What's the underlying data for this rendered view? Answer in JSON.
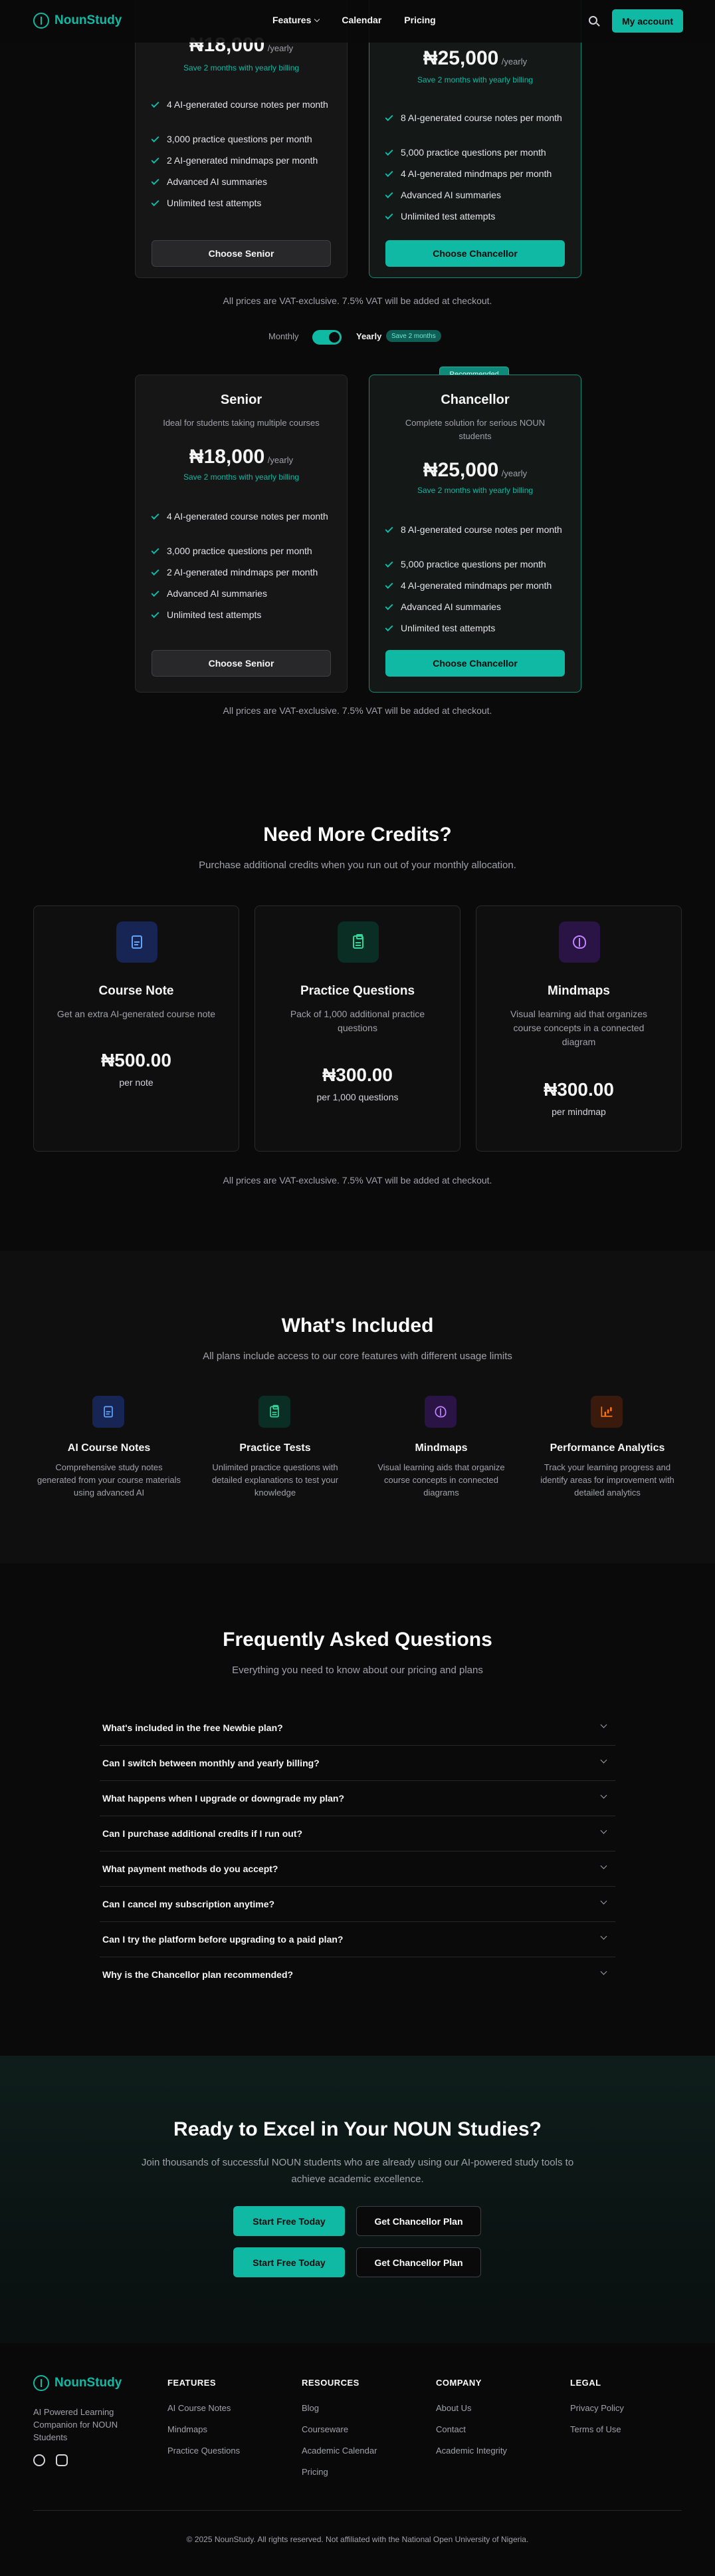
{
  "nav": {
    "brand": "NounStudy",
    "features": "Features",
    "calendar": "Calendar",
    "pricing": "Pricing",
    "account": "My account"
  },
  "plans_top": {
    "senior": {
      "price": "₦18,000",
      "period": "/yearly",
      "save": "Save 2 months with yearly billing",
      "features": [
        "4 AI-generated course notes per month",
        "3,000 practice questions per month",
        "2 AI-generated mindmaps per month",
        "Advanced AI summaries",
        "Unlimited test attempts"
      ],
      "button": "Choose Senior"
    },
    "chancellor": {
      "price": "₦25,000",
      "period": "/yearly",
      "save": "Save 2 months with yearly billing",
      "features": [
        "8 AI-generated course notes per month",
        "5,000 practice questions per month",
        "4 AI-generated mindmaps per month",
        "Advanced AI summaries",
        "Unlimited test attempts"
      ],
      "button": "Choose Chancellor"
    },
    "vat": "All prices are VAT-exclusive. 7.5% VAT will be added at checkout."
  },
  "billing_toggle": {
    "monthly": "Monthly",
    "yearly": "Yearly",
    "save_pill": "Save 2 months"
  },
  "plans": {
    "senior": {
      "title": "Senior",
      "subtitle": "Ideal for students taking multiple courses",
      "price": "₦18,000",
      "period": "/yearly",
      "save": "Save 2 months with yearly billing",
      "features": [
        "4 AI-generated course notes per month",
        "3,000 practice questions per month",
        "2 AI-generated mindmaps per month",
        "Advanced AI summaries",
        "Unlimited test attempts"
      ],
      "button": "Choose Senior"
    },
    "chancellor": {
      "badge": "Recommended",
      "title": "Chancellor",
      "subtitle": "Complete solution for serious NOUN students",
      "price": "₦25,000",
      "period": "/yearly",
      "save": "Save 2 months with yearly billing",
      "features": [
        "8 AI-generated course notes per month",
        "5,000 practice questions per month",
        "4 AI-generated mindmaps per month",
        "Advanced AI summaries",
        "Unlimited test attempts"
      ],
      "button": "Choose Chancellor"
    },
    "vat": "All prices are VAT-exclusive. 7.5% VAT will be added at checkout."
  },
  "credits": {
    "title": "Need More Credits?",
    "lead": "Purchase additional credits when you run out of your monthly allocation.",
    "items": [
      {
        "icon": "document-icon",
        "color": "#60a5fa",
        "title": "Course Note",
        "desc": "Get an extra AI-generated course note",
        "price": "₦500.00",
        "unit": "per note"
      },
      {
        "icon": "clipboard-icon",
        "color": "#34d399",
        "title": "Practice Questions",
        "desc": "Pack of 1,000 additional practice questions",
        "price": "₦300.00",
        "unit": "per 1,000 questions"
      },
      {
        "icon": "brain-icon",
        "color": "#c084fc",
        "title": "Mindmaps",
        "desc": "Visual learning aid that organizes course concepts in a connected diagram",
        "price": "₦300.00",
        "unit": "per mindmap"
      }
    ],
    "vat": "All prices are VAT-exclusive. 7.5% VAT will be added at checkout."
  },
  "included": {
    "title": "What's Included",
    "lead": "All plans include access to our core features with different usage limits",
    "items": [
      {
        "icon": "document-icon",
        "color": "#60a5fa",
        "title": "AI Course Notes",
        "desc": "Comprehensive study notes generated from your course materials using advanced AI"
      },
      {
        "icon": "clipboard-icon",
        "color": "#34d399",
        "title": "Practice Tests",
        "desc": "Unlimited practice questions with detailed explanations to test your knowledge"
      },
      {
        "icon": "brain-icon",
        "color": "#c084fc",
        "title": "Mindmaps",
        "desc": "Visual learning aids that organize course concepts in connected diagrams"
      },
      {
        "icon": "bar-chart-icon",
        "color": "#f97316",
        "title": "Performance Analytics",
        "desc": "Track your learning progress and identify areas for improvement with detailed analytics"
      }
    ]
  },
  "faq": {
    "title": "Frequently Asked Questions",
    "lead": "Everything you need to know about our pricing and plans",
    "questions": [
      "What's included in the free Newbie plan?",
      "Can I switch between monthly and yearly billing?",
      "What happens when I upgrade or downgrade my plan?",
      "Can I purchase additional credits if I run out?",
      "What payment methods do you accept?",
      "Can I cancel my subscription anytime?",
      "Can I try the platform before upgrading to a paid plan?",
      "Why is the Chancellor plan recommended?"
    ]
  },
  "cta": {
    "title": "Ready to Excel in Your NOUN Studies?",
    "lead": "Join thousands of successful NOUN students who are already using our AI-powered study tools to achieve academic excellence.",
    "primary": "Start Free Today",
    "secondary": "Get Chancellor Plan"
  },
  "footer": {
    "brand": "NounStudy",
    "desc": "AI Powered Learning Companion for NOUN Students",
    "features_head": "FEATURES",
    "features": [
      "AI Course Notes",
      "Mindmaps",
      "Practice Questions"
    ],
    "resources_head": "RESOURCES",
    "resources": [
      "Blog",
      "Courseware",
      "Academic Calendar",
      "Pricing"
    ],
    "company_head": "COMPANY",
    "company": [
      "About Us",
      "Contact",
      "Academic Integrity"
    ],
    "legal_head": "LEGAL",
    "legal": [
      "Privacy Policy",
      "Terms of Use"
    ],
    "copyright": "© 2025 NounStudy. All rights reserved. Not affiliated with the National Open University of Nigeria."
  },
  "colors": {
    "accent": "#10b9a3",
    "background": "#0a0a0b",
    "card": "#161617"
  }
}
